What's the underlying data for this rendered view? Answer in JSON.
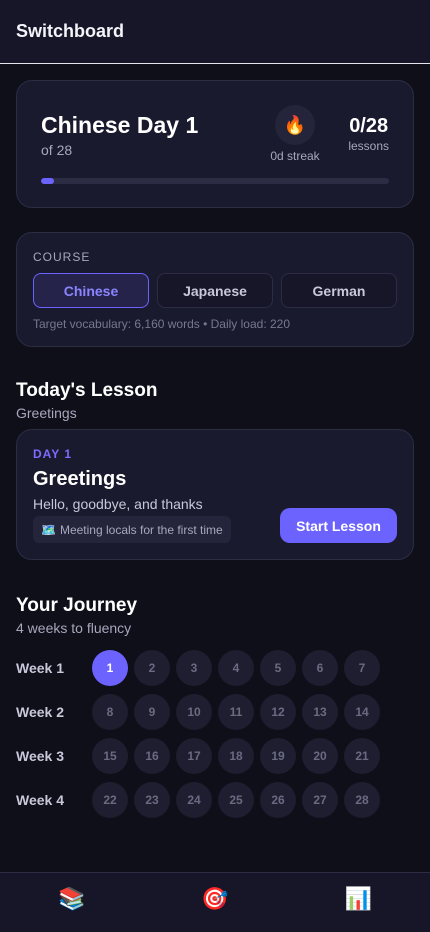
{
  "app": {
    "title": "Switchboard"
  },
  "progress": {
    "title": "Chinese Day 1",
    "subtitle": "of 28",
    "streak_icon": "🔥",
    "streak_label": "0d streak",
    "lessons_count": "0/28",
    "lessons_label": "lessons",
    "progress_fraction": 0.036,
    "accent_color": "#6c63ff"
  },
  "course": {
    "label": "COURSE",
    "options": [
      {
        "label": "Chinese",
        "selected": true
      },
      {
        "label": "Japanese",
        "selected": false
      },
      {
        "label": "German",
        "selected": false
      }
    ],
    "meta": "Target vocabulary: 6,160 words • Daily load: 220"
  },
  "today": {
    "heading": "Today's Lesson",
    "subheading": "Greetings",
    "day_label": "DAY 1",
    "title": "Greetings",
    "description": "Hello, goodbye, and thanks",
    "tag_icon": "🗺️",
    "tag_text": "Meeting locals for the first time",
    "start_label": "Start Lesson"
  },
  "journey": {
    "heading": "Your Journey",
    "subheading": "4 weeks to fluency",
    "current_day": 1,
    "weeks": [
      {
        "label": "Week 1",
        "days": [
          "1",
          "2",
          "3",
          "4",
          "5",
          "6",
          "7"
        ]
      },
      {
        "label": "Week 2",
        "days": [
          "8",
          "9",
          "10",
          "11",
          "12",
          "13",
          "14"
        ]
      },
      {
        "label": "Week 3",
        "days": [
          "15",
          "16",
          "17",
          "18",
          "19",
          "20",
          "21"
        ]
      },
      {
        "label": "Week 4",
        "days": [
          "22",
          "23",
          "24",
          "25",
          "26",
          "27",
          "28"
        ]
      }
    ]
  },
  "nav": {
    "items": [
      {
        "icon": "📚",
        "icon_name": "books-icon",
        "label": "",
        "active": true
      },
      {
        "icon": "🎯",
        "icon_name": "target-icon",
        "label": "",
        "active": false
      },
      {
        "icon": "📊",
        "icon_name": "bar-chart-icon",
        "label": "",
        "active": false
      }
    ]
  }
}
